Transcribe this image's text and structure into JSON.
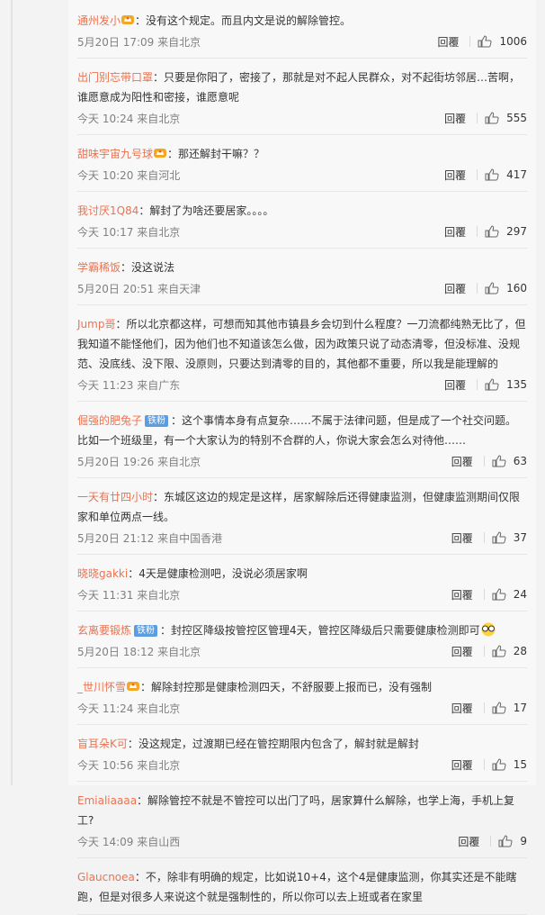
{
  "actions": {
    "reply_label": "回覆"
  },
  "comments": [
    {
      "user": "通州发小",
      "badge": "crown",
      "content": "：没有这个规定。而且内文是说的解除管控。",
      "time": "5月20日 17:09 来自北京",
      "likes": "1006"
    },
    {
      "user": "出门别忘带口罩",
      "badge": "",
      "content": "：只要是你阳了，密接了，那就是对不起人民群众，对不起街坊邻居…苦啊，谁愿意成为阳性和密接，谁愿意呢",
      "time": "今天 10:24 来自北京",
      "likes": "555"
    },
    {
      "user": "甜味宇宙九号球",
      "badge": "crown",
      "content": "：那还解封干嘛？？",
      "time": "今天 10:20 来自河北",
      "likes": "417"
    },
    {
      "user": "我讨厌1Q84",
      "badge": "",
      "content": "：解封了为啥还要居家。。。。",
      "time": "今天 10:17 来自北京",
      "likes": "297"
    },
    {
      "user": "学霸稀饭",
      "badge": "",
      "content": "：没这说法",
      "time": "5月20日 20:51 来自天津",
      "likes": "160"
    },
    {
      "user": "Jump哥",
      "badge": "",
      "content": "：所以北京都这样，可想而知其他市镇县乡会切到什么程度？一刀流都纯熟无比了，但我知道不能怪他们，因为他们也不知道该怎么做，因为政策只说了动态清零，但没标准、没规范、没底线、没下限、没原则，只要达到清零的目的，其他都不重要，所以我是能理解的",
      "time": "今天 11:23 来自广东",
      "likes": "135"
    },
    {
      "user": "倔强的肥兔子",
      "badge": "tie",
      "badge_text": "铁粉",
      "content": "：这个事情本身有点复杂……不属于法律问题，但是成了一个社交问题。比如一个班级里，有一个大家认为的特别不合群的人，你说大家会怎么对待他……",
      "time": "5月20日 19:26 来自北京",
      "likes": "63"
    },
    {
      "user": "一天有廿四小时",
      "badge": "",
      "content": "：东城区这边的规定是这样，居家解除后还得健康监测，但健康监测期间仅限家和单位两点一线。",
      "time": "5月20日 21:12 来自中国香港",
      "likes": "37"
    },
    {
      "user": "晓晓gakki",
      "badge": "",
      "content": "：4天是健康检测吧，没说必须居家啊",
      "time": "今天 11:31 来自北京",
      "likes": "24"
    },
    {
      "user": "玄离要锻炼",
      "badge": "tie",
      "badge_text": "铁粉",
      "content": "：封控区降级按管控区管理4天，管控区降级后只需要健康检测即可",
      "emoji": true,
      "time": "5月20日 18:12 来自北京",
      "likes": "28"
    },
    {
      "user": "_世川怀雪",
      "badge": "crown",
      "content": "：解除封控那是健康检测四天，不舒服要上报而已，没有强制",
      "time": "今天 11:24 来自北京",
      "likes": "17"
    },
    {
      "user": "盲耳朵K可",
      "badge": "",
      "content": "：没这规定，过渡期已经在管控期限内包含了，解封就是解封",
      "time": "今天 10:56 来自北京",
      "likes": "15"
    },
    {
      "user": "Emialiaaaa",
      "badge": "",
      "content": "：解除管控不就是不管控可以出门了吗，居家算什么解除，也学上海，手机上复工?",
      "time": "今天 14:09 来自山西",
      "likes": "9"
    },
    {
      "user": "Glaucnoea",
      "badge": "",
      "content": "：不，除非有明确的规定，比如说10+4，这个4是健康监测，你其实还是不能瞎跑，但是对很多人来说这个就是强制性的，所以你可以去上班或者在家里",
      "time": "",
      "likes": ""
    }
  ]
}
